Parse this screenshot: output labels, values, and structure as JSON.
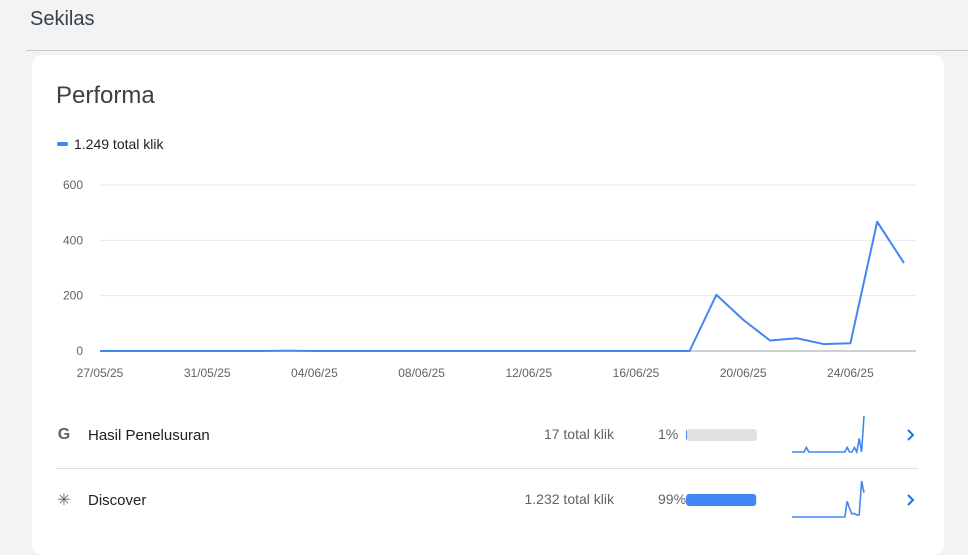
{
  "header": {
    "title": "Sekilas"
  },
  "card": {
    "title": "Performa",
    "legend_label": "1.249 total klik"
  },
  "colors": {
    "accent": "#4285f4",
    "track": "#e0e0e0",
    "text_secondary": "#5f6368"
  },
  "chart_data": {
    "type": "line",
    "ylim": [
      0,
      600
    ],
    "yticks": [
      "0",
      "200",
      "400",
      "600"
    ],
    "xtick_labels": [
      "27/05/25",
      "31/05/25",
      "04/06/25",
      "08/06/25",
      "12/06/25",
      "16/06/25",
      "20/06/25",
      "24/06/25"
    ],
    "grid": true,
    "series": [
      {
        "x": [
          "27/05/25",
          "28/05/25",
          "29/05/25",
          "30/05/25",
          "31/05/25",
          "01/06/25",
          "02/06/25",
          "03/06/25",
          "04/06/25",
          "05/06/25",
          "06/06/25",
          "07/06/25",
          "08/06/25",
          "09/06/25",
          "10/06/25",
          "11/06/25",
          "12/06/25",
          "13/06/25",
          "14/06/25",
          "15/06/25",
          "16/06/25",
          "17/06/25",
          "18/06/25",
          "19/06/25",
          "20/06/25",
          "21/06/25",
          "22/06/25",
          "23/06/25",
          "24/06/25",
          "25/06/25",
          "26/06/25"
        ],
        "values": [
          0,
          0,
          0,
          0,
          0,
          0,
          0,
          1,
          0,
          0,
          0,
          0,
          0,
          0,
          0,
          0,
          0,
          0,
          0,
          0,
          0,
          0,
          0,
          203,
          113,
          38,
          46,
          25,
          28,
          467,
          318
        ]
      }
    ]
  },
  "rows": [
    {
      "icon": "google-g-icon",
      "icon_glyph": "G",
      "label": "Hasil Penelusuran",
      "clicks": "17 total klik",
      "percent": "1%",
      "percent_value": 1,
      "sparkline": [
        0,
        0,
        0,
        0,
        0,
        0,
        1,
        0,
        0,
        0,
        0,
        0,
        0,
        0,
        0,
        0,
        0,
        0,
        0,
        0,
        0,
        0,
        0,
        1,
        0,
        0,
        1,
        0,
        3,
        0,
        8
      ]
    },
    {
      "icon": "discover-asterisk-icon",
      "icon_glyph": "✳",
      "label": "Discover",
      "clicks": "1.232 total klik",
      "percent": "99%",
      "percent_value": 99,
      "sparkline": [
        0,
        0,
        0,
        0,
        0,
        0,
        0,
        0,
        0,
        0,
        0,
        0,
        0,
        0,
        0,
        0,
        0,
        0,
        0,
        0,
        0,
        0,
        0,
        200,
        110,
        38,
        45,
        25,
        28,
        460,
        310
      ]
    }
  ]
}
